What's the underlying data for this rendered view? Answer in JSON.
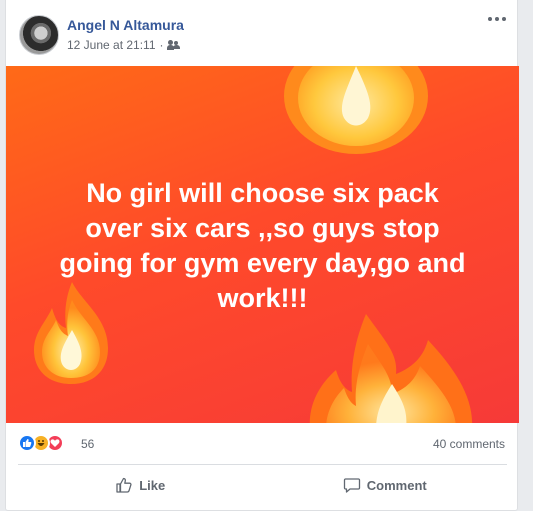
{
  "post": {
    "author": "Angel N Altamura",
    "timestamp": "12 June at 21:11",
    "separator": "·",
    "audience_icon": "friends-icon",
    "more_icon": "more-options-icon",
    "background_colors": [
      "#ff6a17",
      "#f63a38"
    ],
    "text_lines": [
      "No girl will choose six pack",
      "over six cars ,,so guys stop",
      "going for gym every day,go and",
      "work!!!"
    ]
  },
  "reactions": {
    "icons": [
      "like-reaction-icon",
      "haha-reaction-icon",
      "love-reaction-icon"
    ],
    "count": "56",
    "comments": "40 comments"
  },
  "actions": {
    "like_label": "Like",
    "comment_label": "Comment"
  },
  "colors": {
    "author_link": "#365899",
    "like_blue": "#1877f2",
    "love_red": "#f33e58",
    "haha_yellow": "#f7b125"
  }
}
